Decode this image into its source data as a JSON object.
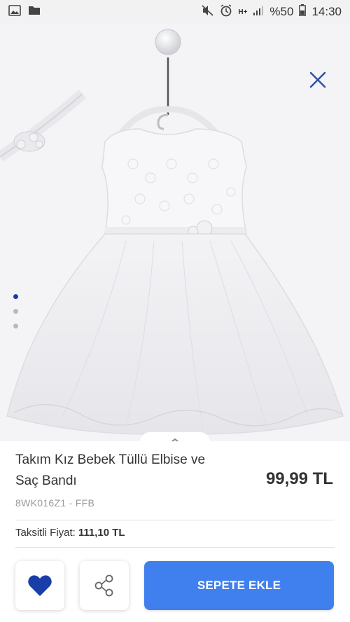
{
  "status_bar": {
    "battery": "%50",
    "time": "14:30",
    "network": "H+"
  },
  "product": {
    "title": "Takım Kız Bebek Tüllü Elbise ve Saç Bandı",
    "price": "99,99 TL",
    "sku": "8WK016Z1 - FFB",
    "installment_label": "Taksitli Fiyat:",
    "installment_price": "111,10 TL"
  },
  "gallery": {
    "image_count": 3,
    "active_index": 0
  },
  "actions": {
    "add_to_cart_label": "SEPETE EKLE"
  },
  "colors": {
    "accent_blue": "#3f80ee",
    "heart_blue": "#1a3ea8",
    "close_blue": "#2e4fa8"
  },
  "icons": {
    "close": "close-icon",
    "favorite": "heart-icon",
    "share": "share-icon",
    "expand": "chevron-up-icon"
  }
}
